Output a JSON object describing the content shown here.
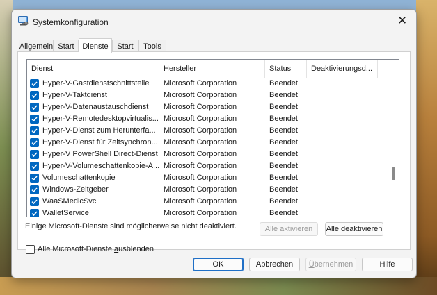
{
  "window": {
    "title": "Systemkonfiguration",
    "close_glyph": "✕"
  },
  "tabs": [
    {
      "label": "Allgemein",
      "active": false
    },
    {
      "label": "Start",
      "active": false
    },
    {
      "label": "Dienste",
      "active": true
    },
    {
      "label": "Start",
      "active": false
    },
    {
      "label": "Tools",
      "active": false
    }
  ],
  "table": {
    "columns": [
      "Dienst",
      "Hersteller",
      "Status",
      "Deaktivierungsd..."
    ],
    "rows": [
      {
        "checked": true,
        "name": "Hyper-V-Gastdienstschnittstelle",
        "vendor": "Microsoft Corporation",
        "status": "Beendet",
        "disabled_date": ""
      },
      {
        "checked": true,
        "name": "Hyper-V-Taktdienst",
        "vendor": "Microsoft Corporation",
        "status": "Beendet",
        "disabled_date": ""
      },
      {
        "checked": true,
        "name": "Hyper-V-Datenaustauschdienst",
        "vendor": "Microsoft Corporation",
        "status": "Beendet",
        "disabled_date": ""
      },
      {
        "checked": true,
        "name": "Hyper-V-Remotedesktopvirtualis...",
        "vendor": "Microsoft Corporation",
        "status": "Beendet",
        "disabled_date": ""
      },
      {
        "checked": true,
        "name": "Hyper-V-Dienst zum Herunterfa...",
        "vendor": "Microsoft Corporation",
        "status": "Beendet",
        "disabled_date": ""
      },
      {
        "checked": true,
        "name": "Hyper-V-Dienst für Zeitsynchron...",
        "vendor": "Microsoft Corporation",
        "status": "Beendet",
        "disabled_date": ""
      },
      {
        "checked": true,
        "name": "Hyper-V PowerShell Direct-Dienst",
        "vendor": "Microsoft Corporation",
        "status": "Beendet",
        "disabled_date": ""
      },
      {
        "checked": true,
        "name": "Hyper-V-Volumeschattenkopie-A...",
        "vendor": "Microsoft Corporation",
        "status": "Beendet",
        "disabled_date": ""
      },
      {
        "checked": true,
        "name": "Volumeschattenkopie",
        "vendor": "Microsoft Corporation",
        "status": "Beendet",
        "disabled_date": ""
      },
      {
        "checked": true,
        "name": "Windows-Zeitgeber",
        "vendor": "Microsoft Corporation",
        "status": "Beendet",
        "disabled_date": ""
      },
      {
        "checked": true,
        "name": "WaaSMedicSvc",
        "vendor": "Microsoft Corporation",
        "status": "Beendet",
        "disabled_date": ""
      },
      {
        "checked": true,
        "name": "WalletService",
        "vendor": "Microsoft Corporation",
        "status": "Beendet",
        "disabled_date": ""
      }
    ]
  },
  "note": "Einige Microsoft-Dienste sind möglicherweise nicht deaktiviert.",
  "enable_all_label": "Alle aktivieren",
  "disable_all_label": "Alle deaktivieren",
  "hide_ms": {
    "checked": false,
    "label_pre": "Alle Microsoft-Dienste ",
    "label_accel": "a",
    "label_post": "usblenden"
  },
  "footer": {
    "ok_label": "OK",
    "cancel_label": "Abbrechen",
    "apply_accel": "Ü",
    "apply_rest": "bernehmen",
    "help_label": "Hilfe"
  },
  "colors": {
    "accent": "#0067c0",
    "window_bg": "#f3f3f3"
  }
}
